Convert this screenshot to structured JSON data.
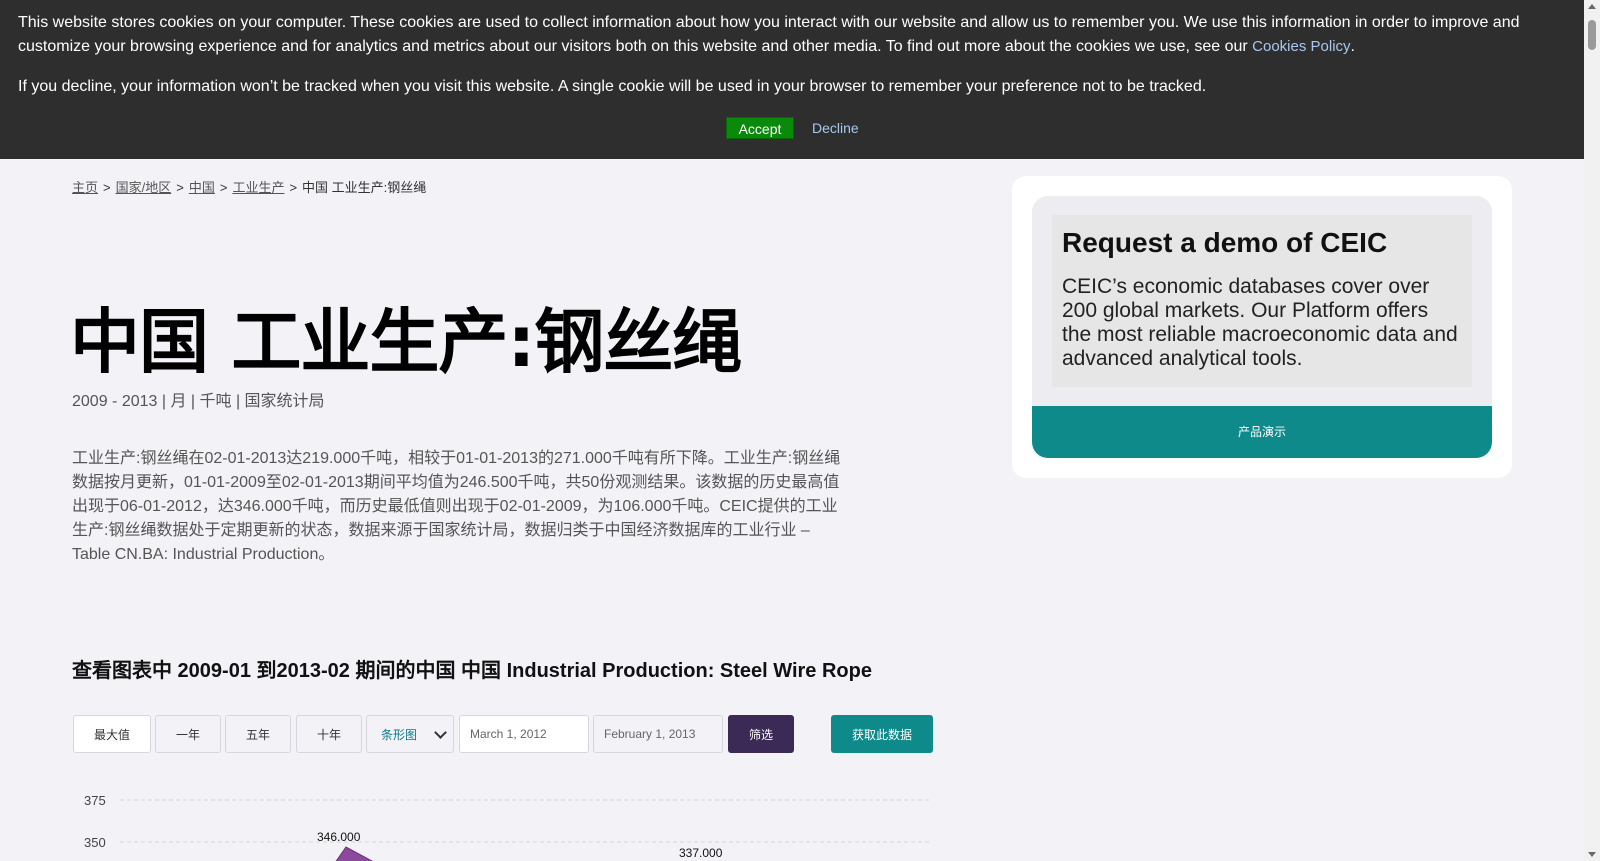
{
  "cookie_banner": {
    "text1": "This website stores cookies on your computer. These cookies are used to collect information about how you interact with our website and allow us to remember you. We use this information in order to improve and customize your browsing experience and for analytics and metrics about our visitors both on this website and other media. To find out more about the cookies we use, see our ",
    "policy_link": "Cookies Policy",
    "text1_end": ".",
    "text2": "If you decline, your information won’t be tracked when you visit this website. A single cookie will be used in your browser to remember your preference not to be tracked.",
    "accept_label": "Accept",
    "decline_label": "Decline"
  },
  "breadcrumb": {
    "items": [
      "主页",
      "国家/地区",
      "中国",
      "工业生产"
    ],
    "current": "中国 工业生产:钢丝绳",
    "separator": ">"
  },
  "page": {
    "title": "中国 工业生产:钢丝绳",
    "meta": "2009 - 2013 | 月 | 千吨 | 国家统计局",
    "description": "工业生产:钢丝绳在02-01-2013达219.000千吨，相较于01-01-2013的271.000千吨有所下降。工业生产:钢丝绳数据按月更新，01-01-2009至02-01-2013期间平均值为246.500千吨，共50份观测结果。该数据的历史最高值出现于06-01-2012，达346.000千吨，而历史最低值则出现于02-01-2009，为106.000千吨。CEIC提供的工业生产:钢丝绳数据处于定期更新的状态，数据来源于国家统计局，数据归类于中国经济数据库的工业行业 – Table CN.BA: Industrial Production。",
    "chart_heading": "查看图表中 2009-01 到2013-02 期间的中国 中国 Industrial Production: Steel Wire Rope"
  },
  "controls": {
    "max": "最大值",
    "one_year": "一年",
    "five_year": "五年",
    "ten_year": "十年",
    "chart_type": "条形图",
    "date_from": "March 1, 2012",
    "date_to": "February 1, 2013",
    "filter": "筛选",
    "get_data": "获取此数据"
  },
  "sidebar": {
    "heading": "Request a demo of CEIC",
    "body": "CEIC’s economic databases cover over 200 global markets. Our Platform offers the most reliable macroeconomic data and advanced analytical tools.",
    "button": "产品演示"
  },
  "chart_data": {
    "type": "area",
    "y_ticks": [
      "375",
      "350"
    ],
    "visible_labels": [
      "346.000",
      "337.000"
    ],
    "colors": {
      "series": "#8b4a9c",
      "grid": "#d8d8d8"
    }
  }
}
